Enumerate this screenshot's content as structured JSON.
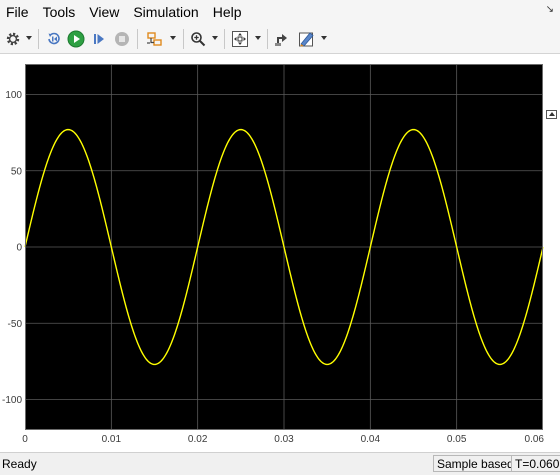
{
  "menu": {
    "items": [
      "File",
      "Tools",
      "View",
      "Simulation",
      "Help"
    ],
    "corner_icon": "minimize-arrow-icon"
  },
  "toolbar": {
    "icons": [
      "settings-gear-icon",
      "step-back-icon",
      "run-icon",
      "step-forward-icon",
      "stop-icon",
      "signal-select-icon",
      "zoom-in-icon",
      "fit-to-view-icon",
      "highlight-block-icon",
      "style-icon"
    ],
    "run_color": "#2ea043"
  },
  "plot": {
    "background": "#000000",
    "trace_color": "#ffff00",
    "undock_icon": "undock-icon"
  },
  "status": {
    "text": "Ready",
    "mode": "Sample based",
    "time": "T=0.060"
  },
  "chart_data": {
    "type": "line",
    "title": "",
    "xlabel": "",
    "ylabel": "",
    "xlim": [
      0,
      0.06
    ],
    "ylim": [
      -120,
      120
    ],
    "x_ticks": [
      0,
      0.01,
      0.02,
      0.03,
      0.04,
      0.05,
      0.06
    ],
    "x_tick_labels": [
      "0",
      "0.01",
      "0.02",
      "0.03",
      "0.04",
      "0.05",
      "0.06"
    ],
    "y_ticks": [
      -100,
      -50,
      0,
      50,
      100
    ],
    "y_tick_labels": [
      "-100",
      "-50",
      "0",
      "50",
      "100"
    ],
    "grid": true,
    "series": [
      {
        "amplitude": 77,
        "frequency_hz": 50,
        "x": [
          0,
          0.0025,
          0.005,
          0.0075,
          0.01,
          0.0125,
          0.015,
          0.0175,
          0.02,
          0.0225,
          0.025,
          0.0275,
          0.03,
          0.0325,
          0.035,
          0.0375,
          0.04,
          0.0425,
          0.045,
          0.0475,
          0.05,
          0.0525,
          0.055,
          0.0575,
          0.06
        ],
        "y": [
          0,
          54.4,
          77,
          54.4,
          0,
          -54.4,
          -77,
          -54.4,
          0,
          54.4,
          77,
          54.4,
          0,
          -54.4,
          -77,
          -54.4,
          0,
          54.4,
          77,
          54.4,
          0,
          -54.4,
          -77,
          -54.4,
          0
        ]
      }
    ]
  }
}
